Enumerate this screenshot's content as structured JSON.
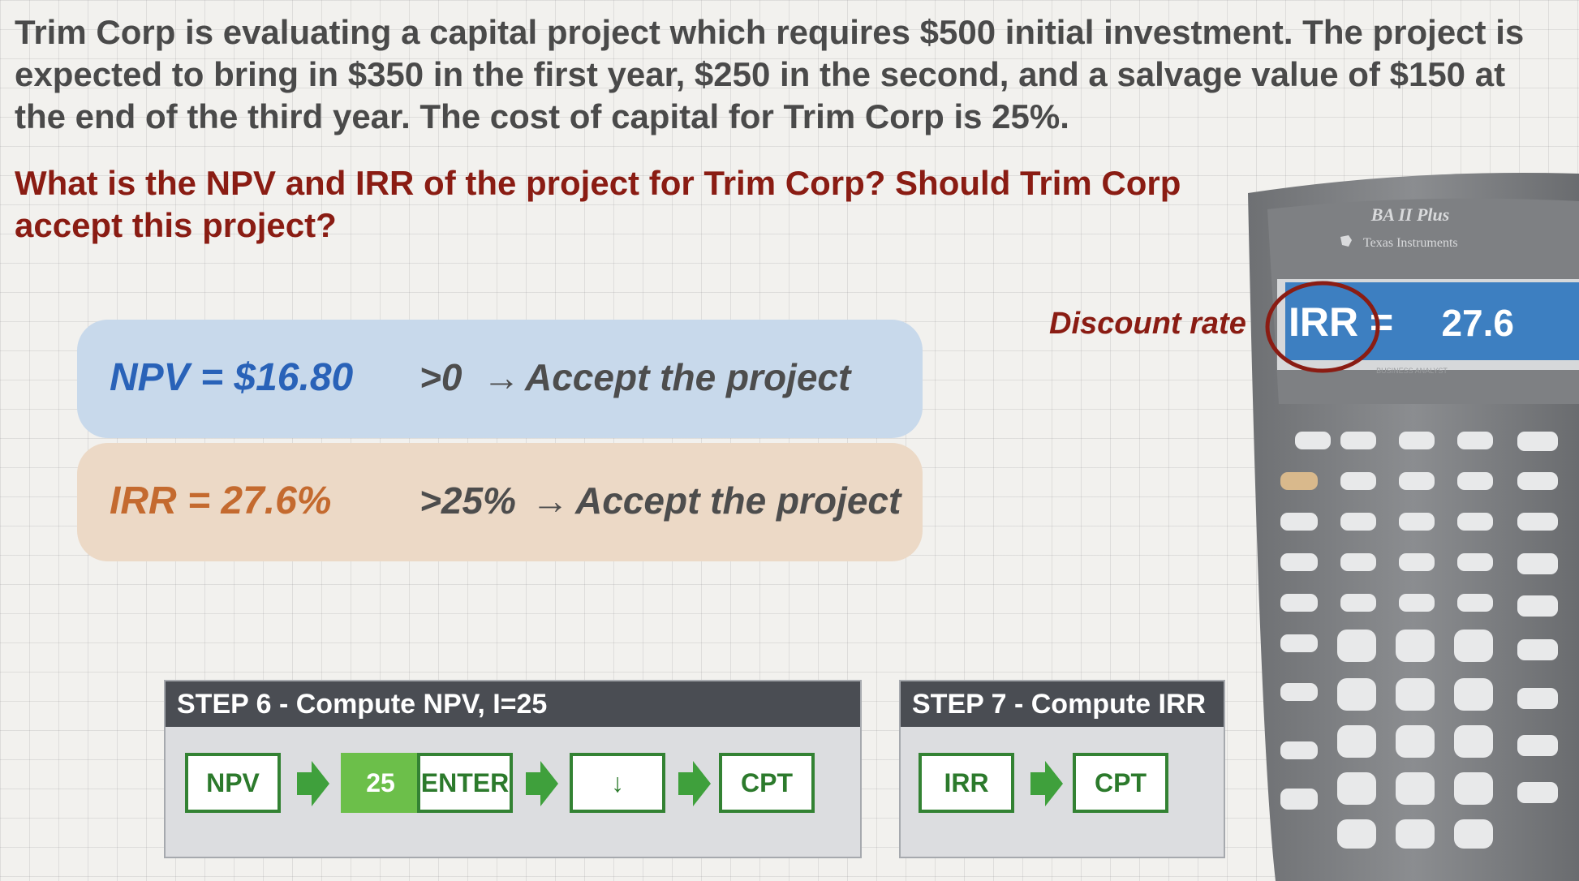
{
  "problem": {
    "statement": "Trim Corp is evaluating a capital project which requires $500 initial investment.  The project is expected to bring in $350 in the first year, $250 in the second, and a salvage value of $150 at the end of the third year.  The cost of capital for Trim Corp is 25%.",
    "question": "What is the NPV and IRR of the project for Trim Corp?  Should Trim Corp accept this project?"
  },
  "results": {
    "npv": {
      "formula": "NPV = $16.80",
      "condition": ">0",
      "conclusion": "Accept the project"
    },
    "irr": {
      "formula": "IRR = 27.6%",
      "condition": ">25%",
      "conclusion": "Accept the project"
    }
  },
  "annotation": {
    "discount_rate_label": "Discount rate"
  },
  "steps": [
    {
      "title": "STEP 6 - Compute NPV, I=25",
      "keys": [
        "NPV",
        "25",
        "ENTER",
        "↓",
        "CPT"
      ]
    },
    {
      "title": "STEP 7 - Compute IRR",
      "keys": [
        "IRR",
        "CPT"
      ]
    }
  ],
  "calculator": {
    "model": "BA II Plus",
    "brand": "Texas Instruments",
    "screen_label": "IRR =",
    "screen_value": "27.6",
    "screen_sub": "BUSINESS ANALYST"
  },
  "colors": {
    "question": "#8a1c13",
    "npv_text": "#2962b8",
    "irr_text": "#c46a2f",
    "key_border": "#338233",
    "key_green": "#6cbf4a",
    "step_header": "#4a4d53",
    "calc_screen": "#3d7fc1"
  },
  "icons": [
    "right-arrow-icon",
    "ti-logo-icon",
    "circle-highlight-icon"
  ]
}
